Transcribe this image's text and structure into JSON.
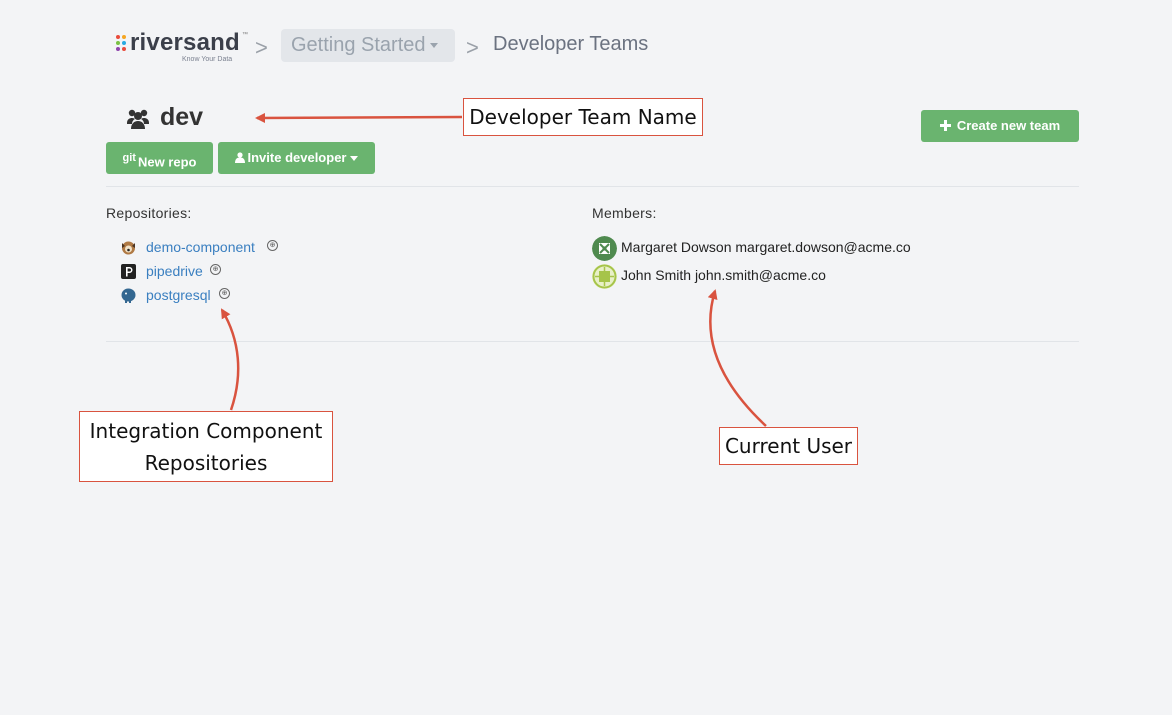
{
  "header": {
    "logo": {
      "wordmark": "riversand",
      "trademark": "™",
      "tagline": "Know Your Data"
    },
    "breadcrumb": {
      "separator": ">",
      "dropdown_label": "Getting Started",
      "current": "Developer Teams"
    }
  },
  "team": {
    "name": "dev",
    "icon": "users-icon",
    "buttons": {
      "new_repo_prefix": "git",
      "new_repo": "New repo",
      "invite": "Invite developer",
      "create": "Create new team"
    }
  },
  "repositories": {
    "heading": "Repositories:",
    "items": [
      {
        "name": "demo-component",
        "icon": "dog-avatar-icon",
        "badge": "public-icon"
      },
      {
        "name": "pipedrive",
        "icon": "pipedrive-p-icon",
        "badge": "public-icon"
      },
      {
        "name": "postgresql",
        "icon": "postgres-elephant-icon",
        "badge": "public-icon"
      }
    ]
  },
  "members": {
    "heading": "Members:",
    "items": [
      {
        "name": "Margaret Dowson",
        "email": "margaret.dowson@acme.co",
        "avatar_color": "#4f8a4f"
      },
      {
        "name": "John Smith",
        "email": "john.smith@acme.co",
        "avatar_color": "#a6c44a"
      }
    ]
  },
  "annotations": {
    "team_name": "Developer Team Name",
    "repos_line1": "Integration Component",
    "repos_line2": "Repositories",
    "current_user": "Current User",
    "color": "#d9533f"
  }
}
